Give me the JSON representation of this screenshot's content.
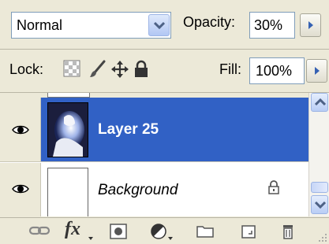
{
  "blend_mode": {
    "value": "Normal"
  },
  "opacity": {
    "label": "Opacity:",
    "value": "30%"
  },
  "lock": {
    "label": "Lock:"
  },
  "fill": {
    "label": "Fill:",
    "value": "100%"
  },
  "layers": [
    {
      "name": "Layer 25",
      "selected": true,
      "visible": true
    },
    {
      "name": "Background",
      "selected": false,
      "visible": true,
      "locked": true
    }
  ],
  "toolbar": {
    "fx_label": "fx"
  },
  "colors": {
    "panel_bg": "#ece9d8",
    "selection": "#3161c5",
    "input_border": "#7f9db9"
  }
}
